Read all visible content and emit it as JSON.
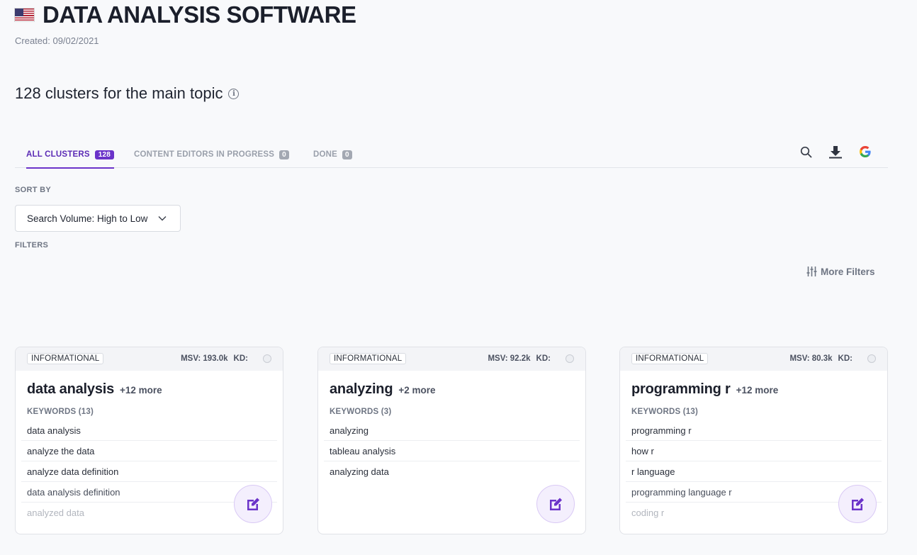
{
  "header": {
    "flag": "us-flag-icon",
    "title": "DATA ANALYSIS SOFTWARE",
    "created": "Created: 09/02/2021"
  },
  "clusters_heading": "128 clusters for the main topic",
  "tabs": [
    {
      "label": "ALL CLUSTERS",
      "count": "128",
      "active": true
    },
    {
      "label": "CONTENT EDITORS IN PROGRESS",
      "count": "0",
      "active": false
    },
    {
      "label": "DONE",
      "count": "0",
      "active": false
    }
  ],
  "toolbar": {
    "icons": [
      "search-icon",
      "download-icon",
      "google-icon"
    ]
  },
  "sort": {
    "label": "SORT BY",
    "value": "Search Volume: High to Low"
  },
  "filters": {
    "label": "FILTERS",
    "more_filters": "More Filters"
  },
  "colors": {
    "accent": "#6b33c9",
    "background": "#f8f9fb"
  },
  "cards": [
    {
      "intent": "INFORMATIONAL",
      "msv": "MSV: 193.0k",
      "kd": "KD:",
      "name": "data analysis",
      "more": "+12 more",
      "keywords_label": "KEYWORDS (13)",
      "keywords": [
        "data analysis",
        "analyze the data",
        "analyze data definition",
        "data analysis definition",
        "analyzed data"
      ]
    },
    {
      "intent": "INFORMATIONAL",
      "msv": "MSV: 92.2k",
      "kd": "KD:",
      "name": "analyzing",
      "more": "+2 more",
      "keywords_label": "KEYWORDS (3)",
      "keywords": [
        "analyzing",
        "tableau analysis",
        "analyzing data"
      ]
    },
    {
      "intent": "INFORMATIONAL",
      "msv": "MSV: 80.3k",
      "kd": "KD:",
      "name": "programming r",
      "more": "+12 more",
      "keywords_label": "KEYWORDS (13)",
      "keywords": [
        "programming r",
        "how r",
        "r language",
        "programming language r",
        "coding r"
      ]
    }
  ]
}
